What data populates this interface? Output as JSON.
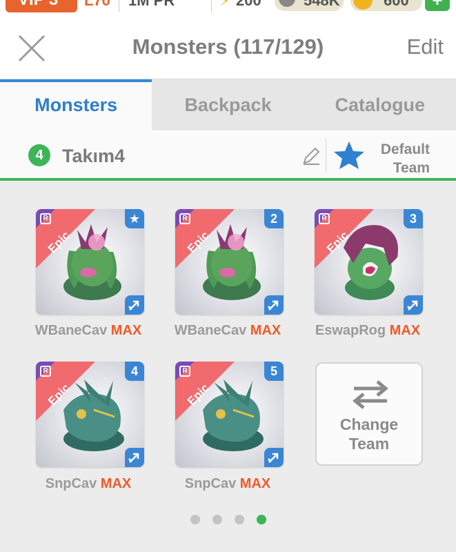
{
  "status": {
    "vip_label": "VIP 3",
    "level": "L70",
    "power": "1M PR",
    "energy": "200",
    "food": "548K",
    "gold": "600"
  },
  "header": {
    "title": "Monsters (117/129)",
    "edit_label": "Edit"
  },
  "tabs": [
    {
      "label": "Monsters",
      "active": true
    },
    {
      "label": "Backpack",
      "active": false
    },
    {
      "label": "Catalogue",
      "active": false
    }
  ],
  "team": {
    "number": "4",
    "name": "Takım4",
    "default_label_line1": "Default",
    "default_label_line2": "Team"
  },
  "monsters": [
    {
      "rarity": "Epic",
      "rank": "★",
      "name": "WBaneCav",
      "level": "MAX"
    },
    {
      "rarity": "Epic",
      "rank": "2",
      "name": "WBaneCav",
      "level": "MAX"
    },
    {
      "rarity": "Epic",
      "rank": "3",
      "name": "EswapRog",
      "level": "MAX"
    },
    {
      "rarity": "Epic",
      "rank": "4",
      "name": "SnpCav",
      "level": "MAX"
    },
    {
      "rarity": "Epic",
      "rank": "5",
      "name": "SnpCav",
      "level": "MAX"
    }
  ],
  "change_team": {
    "line1": "Change",
    "line2": "Team"
  },
  "pagination": {
    "pages": 4,
    "active_index": 3
  },
  "colors": {
    "accent_blue": "#3688d4",
    "green": "#3db458",
    "max_orange": "#ef5a2a",
    "epic_red": "#f06a6e",
    "epic_purple": "#7b4bb5"
  }
}
